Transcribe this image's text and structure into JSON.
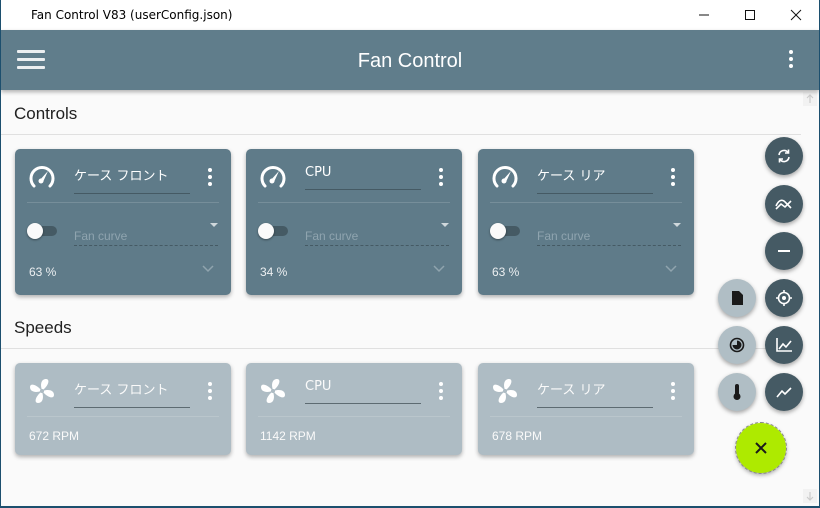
{
  "window": {
    "title": "Fan Control V83 (userConfig.json)",
    "controls": [
      "minimize",
      "maximize",
      "close"
    ]
  },
  "appbar": {
    "title": "Fan Control",
    "menu_icon": "hamburger-menu-icon",
    "more_icon": "more-vert-icon"
  },
  "sections": {
    "controls_title": "Controls",
    "speeds_title": "Speeds"
  },
  "controls": [
    {
      "name": "ケース フロント",
      "curve_placeholder": "Fan curve",
      "value": "63 %",
      "enabled": false,
      "icon": "speedometer-icon"
    },
    {
      "name": "CPU",
      "curve_placeholder": "Fan curve",
      "value": "34 %",
      "enabled": false,
      "icon": "speedometer-icon"
    },
    {
      "name": "ケース リア",
      "curve_placeholder": "Fan curve",
      "value": "63 %",
      "enabled": false,
      "icon": "speedometer-icon"
    }
  ],
  "speeds": [
    {
      "name": "ケース フロント",
      "value": "672 RPM",
      "icon": "fan-icon"
    },
    {
      "name": "CPU",
      "value": "1142 RPM",
      "icon": "fan-icon"
    },
    {
      "name": "ケース リア",
      "value": "678 RPM",
      "icon": "fan-icon"
    }
  ],
  "fab_menu": {
    "right_column": [
      "refresh-icon",
      "mix-curve-icon",
      "minus-icon",
      "target-icon",
      "graph-icon",
      "trend-icon"
    ],
    "left_column": [
      "file-icon",
      "timer-icon",
      "thermometer-icon"
    ],
    "main": "close-icon",
    "colors": {
      "dark": "#455a64",
      "light": "#b0bec5",
      "accent": "#aeea00"
    }
  },
  "theme": {
    "primary": "#607d8b",
    "card": "#5f7b89",
    "card_light": "#aebcc4"
  }
}
